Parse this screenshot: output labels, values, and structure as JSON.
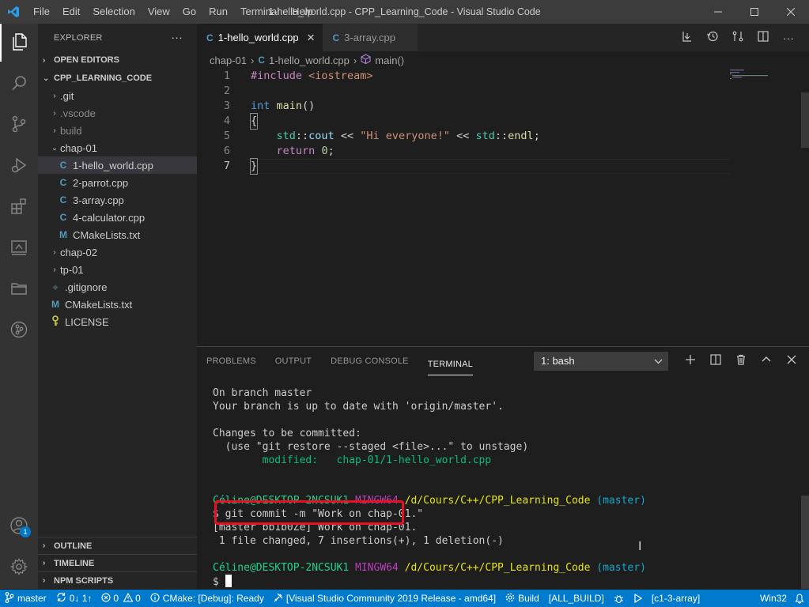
{
  "window": {
    "title": "1-hello_world.cpp - CPP_Learning_Code - Visual Studio Code",
    "menu": [
      "File",
      "Edit",
      "Selection",
      "View",
      "Go",
      "Run",
      "Terminal",
      "Help"
    ]
  },
  "colors": {
    "accent": "#007acc",
    "highlight_box": "#e81123",
    "activity_bar": "#333333",
    "sidebar": "#252526",
    "editor": "#1e1e1e"
  },
  "activity_bar": {
    "items": [
      "files-icon",
      "search-icon",
      "source-control-icon",
      "run-debug-icon",
      "extensions-icon",
      "remote-explorer-icon",
      "folder-icon",
      "gitlens-icon"
    ],
    "account_badge": "1"
  },
  "sidebar": {
    "header": "EXPLORER",
    "more": "···",
    "sections": {
      "open_editors": "OPEN EDITORS",
      "project": "CPP_LEARNING_CODE",
      "outline": "OUTLINE",
      "timeline": "TIMELINE",
      "npm": "NPM SCRIPTS"
    },
    "tree": [
      {
        "label": ".git",
        "chev": "›"
      },
      {
        "label": ".vscode",
        "chev": "›"
      },
      {
        "label": "build",
        "chev": "›"
      },
      {
        "label": "chap-01",
        "chev": "⌄"
      },
      {
        "label": "1-hello_world.cpp",
        "icon": "C"
      },
      {
        "label": "2-parrot.cpp",
        "icon": "C"
      },
      {
        "label": "3-array.cpp",
        "icon": "C"
      },
      {
        "label": "4-calculator.cpp",
        "icon": "C"
      },
      {
        "label": "CMakeLists.txt",
        "icon": "M"
      },
      {
        "label": "chap-02",
        "chev": "›"
      },
      {
        "label": "tp-01",
        "chev": "›"
      },
      {
        "label": ".gitignore",
        "icon": "◆"
      },
      {
        "label": "CMakeLists.txt",
        "icon": "M"
      },
      {
        "label": "LICENSE",
        "icon": "key"
      }
    ]
  },
  "tabs": [
    {
      "label": "1-hello_world.cpp",
      "close": "✕"
    },
    {
      "label": "3-array.cpp"
    }
  ],
  "breadcrumb": {
    "folder": "chap-01",
    "file": "1-hello_world.cpp",
    "symbol": "main()"
  },
  "code": {
    "line_numbers": [
      "1",
      "2",
      "3",
      "4",
      "5",
      "6",
      "7"
    ],
    "l1": {
      "pp": "#include",
      "hdr": "<iostream>"
    },
    "l3": {
      "type": "int",
      "fn": "main",
      "rest": "()"
    },
    "l4": "{",
    "l5": {
      "ns1": "std",
      "c1": "::",
      "v1": "cout",
      "op1": " << ",
      "str": "\"Hi everyone!\"",
      "op2": " << ",
      "ns2": "std",
      "c2": "::",
      "fn2": "endl",
      "end": ";"
    },
    "l6": {
      "ret": "return",
      "num": "0",
      "end": ";"
    },
    "l7": "}"
  },
  "panel": {
    "tabs": [
      "PROBLEMS",
      "OUTPUT",
      "DEBUG CONSOLE",
      "TERMINAL"
    ],
    "active_tab": "TERMINAL",
    "terminal_select": "1: bash",
    "actions": [
      "add-icon",
      "split-icon",
      "trash-icon",
      "chevron-up-icon",
      "close-icon"
    ]
  },
  "terminal": {
    "l1": "On branch master",
    "l2": "Your branch is up to date with 'origin/master'.",
    "l4": "Changes to be committed:",
    "l5": "  (use \"git restore --staged <file>...\" to unstage)",
    "l6_label": "        modified:   ",
    "l6_file": "chap-01/1-hello_world.cpp",
    "prompt_user": "Céline@DESKTOP-2NCSUK1",
    "prompt_env": "MINGW64",
    "prompt_path": "/d/Cours/C++/CPP_Learning_Code",
    "prompt_branch": "(master)",
    "cmd": "$ git commit -m \"Work on chap-01.\"",
    "out1": "[master bb1b0Ze] Work on chap-01.",
    "out2": " 1 file changed, 7 insertions(+), 1 deletion(-)",
    "prompt_symbol": "$ "
  },
  "statusbar": {
    "branch": "master",
    "sync": "0↓ 1↑",
    "errors": "0",
    "warnings": "0",
    "cmake": "CMake: [Debug]: Ready",
    "kit": "[Visual Studio Community 2019 Release - amd64]",
    "build": "Build",
    "target": "[ALL_BUILD]",
    "launch_target": "[c1-3-array]",
    "platform": "Win32"
  }
}
